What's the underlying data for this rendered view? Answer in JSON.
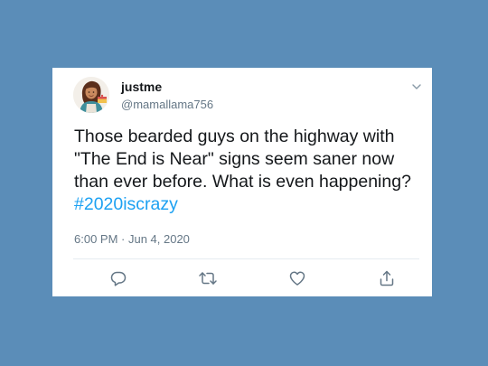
{
  "tweet": {
    "display_name": "justme",
    "handle": "@mamallama756",
    "text_main": "Those bearded guys on the highway with \"The End is Near\" signs seem saner now than ever before.  What is even happening? ",
    "hashtag": "#2020iscrazy",
    "timestamp": "6:00 PM · Jun 4, 2020"
  },
  "actions": [
    {
      "name": "reply",
      "icon": "reply-icon"
    },
    {
      "name": "retweet",
      "icon": "retweet-icon"
    },
    {
      "name": "like",
      "icon": "heart-icon"
    },
    {
      "name": "share",
      "icon": "share-icon"
    }
  ],
  "colors": {
    "background": "#5b8db8",
    "card": "#ffffff",
    "text": "#14171a",
    "secondary": "#657786",
    "link": "#1da1f2"
  }
}
